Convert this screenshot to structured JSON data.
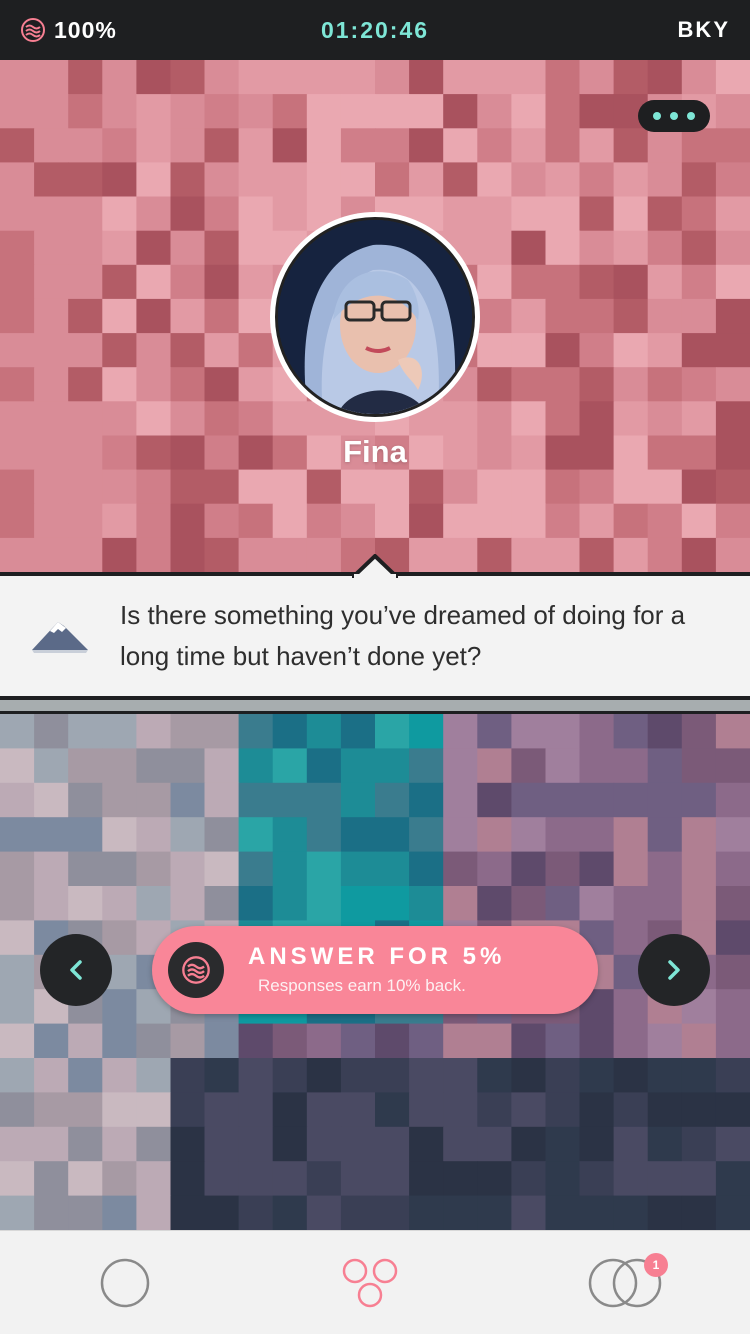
{
  "status_bar": {
    "battery": "100%",
    "time": "01:20:46",
    "carrier": "BKY",
    "battery_icon": "coin-wave-icon"
  },
  "profile": {
    "name": "Fina",
    "more_icon": "ellipsis-icon",
    "background_color": "#d48b95"
  },
  "question": {
    "icon": "mountain-icon",
    "text": "Is there something you’ve dreamed of doing for a long time but haven’t done yet?"
  },
  "answer": {
    "title": "ANSWER FOR 5%",
    "subtitle": "Responses earn 10% back.",
    "prev_icon": "chevron-left-icon",
    "next_icon": "chevron-right-icon",
    "coin_icon": "coin-wave-icon"
  },
  "tab_bar": {
    "tabs": [
      {
        "icon": "circle-icon"
      },
      {
        "icon": "three-circles-icon"
      },
      {
        "icon": "overlapping-circles-icon",
        "badge": "1"
      }
    ]
  },
  "colors": {
    "accent_pink": "#f98698",
    "accent_teal": "#7ee6d6",
    "dark": "#1e1f21"
  }
}
